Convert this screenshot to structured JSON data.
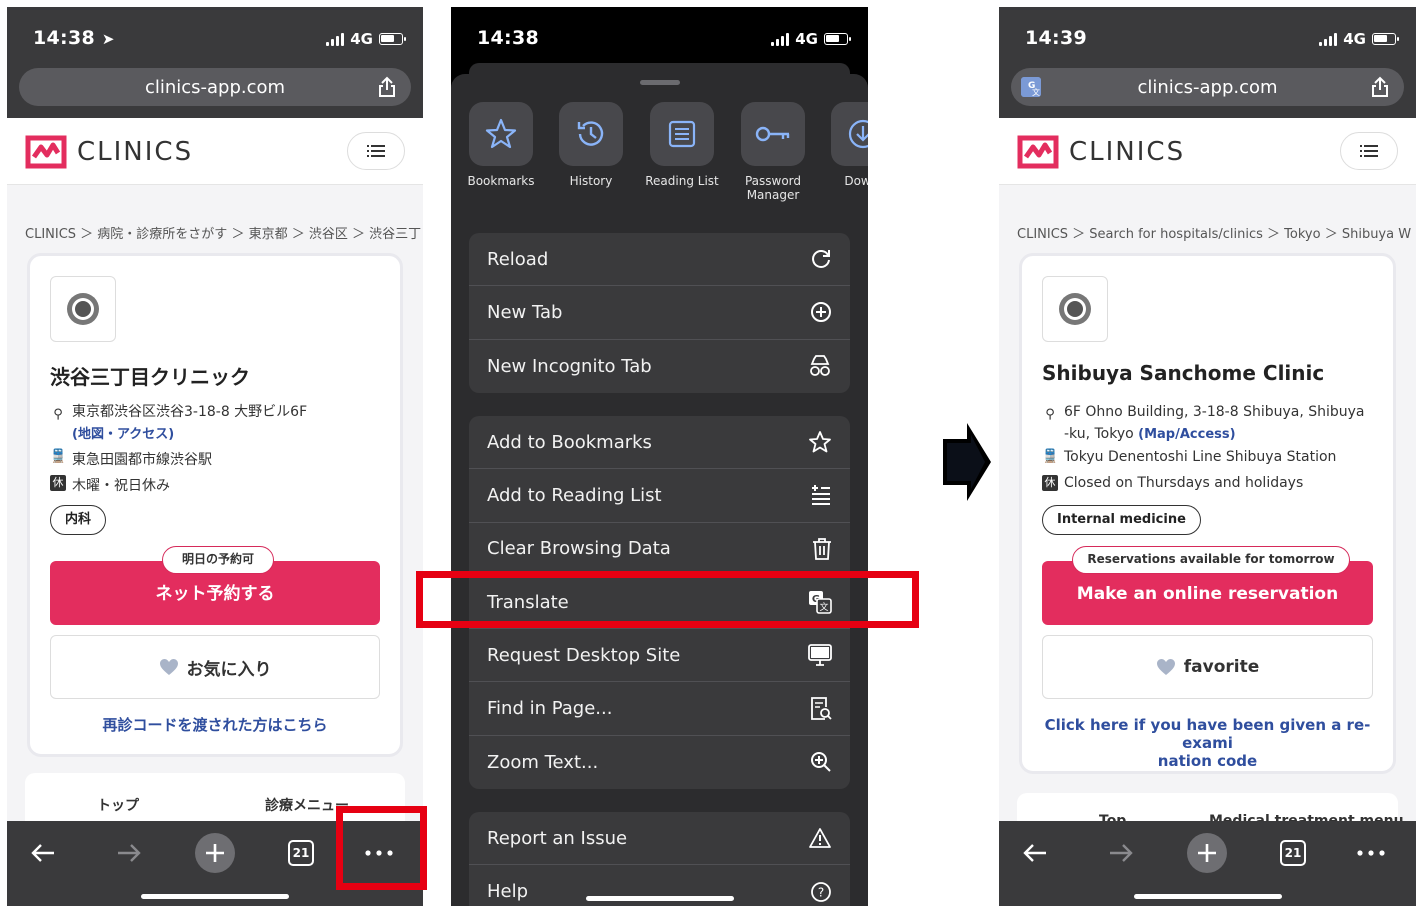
{
  "left": {
    "time": "14:38",
    "network": "4G",
    "url": "clinics-app.com",
    "brand": "CLINICS",
    "breadcrumb": "CLINICS ＞ 病院・診療所をさがす ＞ 東京都 ＞ 渋谷区 ＞ 渋谷三丁",
    "clinic_name": "渋谷三丁目クリニック",
    "address": "東京都渋谷区渋谷3-18-8 大野ビル6F",
    "map_link": "(地図・アクセス)",
    "station": "東急田園都市線渋谷駅",
    "closed": "木曜・祝日休み",
    "closed_badge": "休",
    "department": "内科",
    "tomorrow_badge": "明日の予約可",
    "reserve_label": "ネット予約する",
    "favorite_label": "お気に入り",
    "recode_text": "再診コードを渡された方はこちら",
    "tab_top": "トップ",
    "tab_menu": "診療メニュー",
    "tab_count": "21"
  },
  "middle": {
    "time": "14:38",
    "network": "4G",
    "quick_actions": [
      {
        "label": "Bookmarks",
        "icon": "star-icon"
      },
      {
        "label": "History",
        "icon": "history-icon"
      },
      {
        "label": "Reading List",
        "icon": "reading-list-icon"
      },
      {
        "label": "Password Manager",
        "icon": "key-icon"
      },
      {
        "label": "Downl",
        "icon": "download-icon"
      }
    ],
    "group1": [
      "Reload",
      "New Tab",
      "New Incognito Tab"
    ],
    "group2": [
      "Add to Bookmarks",
      "Add to Reading List",
      "Clear Browsing Data",
      "Translate",
      "Request Desktop Site",
      "Find in Page...",
      "Zoom Text..."
    ],
    "group3": [
      "Report an Issue",
      "Help"
    ]
  },
  "right": {
    "time": "14:39",
    "network": "4G",
    "url": "clinics-app.com",
    "brand": "CLINICS",
    "breadcrumb": "CLINICS ＞ Search for hospitals/clinics ＞ Tokyo ＞ Shibuya W",
    "clinic_name": "Shibuya Sanchome Clinic",
    "address_line1": "6F Ohno Building, 3-18-8 Shibuya, Shibuya",
    "address_line2": "-ku, Tokyo",
    "map_link": "(Map/Access)",
    "station": "Tokyu Denentoshi Line Shibuya Station",
    "closed": "Closed on Thursdays and holidays",
    "closed_badge": "休",
    "department": "Internal medicine",
    "tomorrow_badge": "Reservations available for tomorrow",
    "reserve_label": "Make an online reservation",
    "favorite_label": "favorite",
    "recode_line1": "Click here if you have been given a re-exami",
    "recode_line2": "nation code",
    "tab_top": "Top",
    "tab_menu": "Medical treatment menu",
    "tab_count": "21"
  },
  "colors": {
    "brand_red": "#e32d5e",
    "highlight_red": "#e60012",
    "link_blue": "#2f4e9e",
    "dark_bar": "#3a3a3c"
  }
}
